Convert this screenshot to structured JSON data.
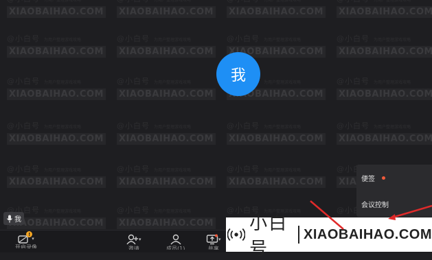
{
  "watermark": {
    "title": "@小白号",
    "subtitle": "XIAOBAIHAO.COM",
    "small": "为用户整理游戏攻略"
  },
  "participant": {
    "avatar_text": "我",
    "mic_label": "我"
  },
  "side_menu": {
    "items": [
      {
        "label": "便签",
        "has_dot": true
      },
      {
        "label": "会议控制",
        "has_dot": false
      }
    ]
  },
  "toolbar": {
    "buttons": [
      {
        "label": "开启录像",
        "icon": "video-icon",
        "badge": "!"
      },
      {
        "label": "邀请",
        "icon": "add-user-icon"
      },
      {
        "label": "成员(1)",
        "icon": "members-icon"
      },
      {
        "label": "共享",
        "icon": "share-screen-icon"
      }
    ]
  },
  "brand": {
    "cn": "小白号",
    "en": "XIAOBAIHAO.COM"
  },
  "colors": {
    "avatar": "#1e8ff5",
    "accent_arrow": "#e02a2a",
    "badge": "#f5a623"
  }
}
